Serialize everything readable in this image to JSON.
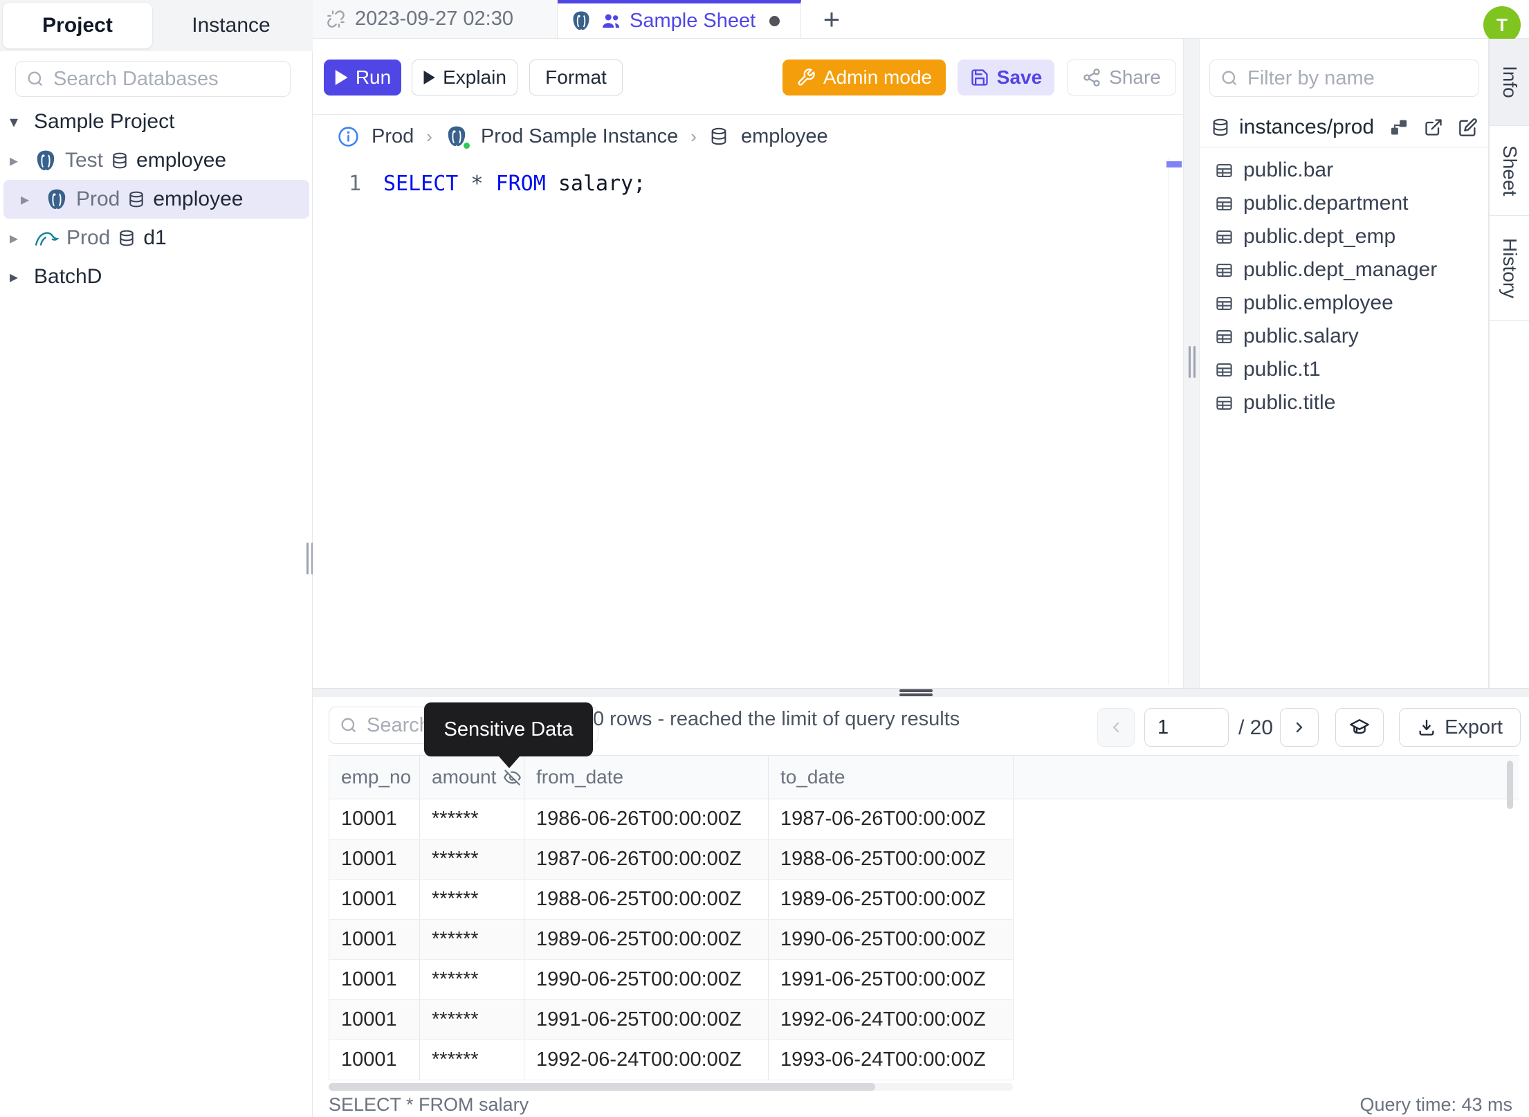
{
  "colors": {
    "accent_indigo": "#4f46e5",
    "admin_orange": "#f59e0b",
    "save_bg": "#e7e5fb",
    "avatar_green": "#7fc41f",
    "tooltip_bg": "#1d1d1f",
    "selected_row_bg": "#e9e8f9",
    "keyword_blue": "#0010f0",
    "status_dot_green": "#34c759"
  },
  "left_sidebar": {
    "tabs": [
      {
        "label": "Project",
        "active": true
      },
      {
        "label": "Instance",
        "active": false
      }
    ],
    "search_placeholder": "Search Databases",
    "tree": [
      {
        "kind": "project",
        "label": "Sample Project",
        "expanded": true,
        "selected": false
      },
      {
        "kind": "database",
        "env": "Test",
        "db": "employee",
        "engine": "postgres",
        "selected": false
      },
      {
        "kind": "database",
        "env": "Prod",
        "db": "employee",
        "engine": "postgres",
        "selected": true
      },
      {
        "kind": "database",
        "env": "Prod",
        "db": "d1",
        "engine": "mysql",
        "selected": false
      },
      {
        "kind": "project",
        "label": "BatchD",
        "expanded": false,
        "selected": false
      }
    ]
  },
  "tab_bar": {
    "tab1_label": "2023-09-27 02:30",
    "tab2_label": "Sample Sheet",
    "new_tab_label": "+",
    "avatar_initial": "T"
  },
  "toolbar": {
    "run_label": "Run",
    "explain_label": "Explain",
    "format_label": "Format",
    "admin_label": "Admin mode",
    "save_label": "Save",
    "share_label": "Share"
  },
  "breadcrumb": {
    "environment": "Prod",
    "instance": "Prod Sample Instance",
    "database": "employee",
    "separator": "›"
  },
  "editor": {
    "line_number": "1",
    "sql_tokens": [
      {
        "text": "SELECT",
        "type": "keyword"
      },
      {
        "text": " * ",
        "type": "operator"
      },
      {
        "text": "FROM",
        "type": "keyword"
      },
      {
        "text": " salary;",
        "type": "plain"
      }
    ]
  },
  "right_sidebar": {
    "filter_placeholder": "Filter by name",
    "connection": "instances/prod",
    "tables": [
      "public.bar",
      "public.department",
      "public.dept_emp",
      "public.dept_manager",
      "public.employee",
      "public.salary",
      "public.t1",
      "public.title"
    ],
    "side_tabs": [
      {
        "label": "Info",
        "active": true
      },
      {
        "label": "Sheet",
        "active": false
      },
      {
        "label": "History",
        "active": false
      }
    ]
  },
  "results": {
    "search_placeholder": "Search",
    "tooltip": "Sensitive Data",
    "summary": "0 rows  -  reached the limit of query results",
    "pagination": {
      "page": "1",
      "total": "/ 20"
    },
    "export_label": "Export",
    "columns": [
      {
        "name": "emp_no",
        "masked": false
      },
      {
        "name": "amount",
        "masked": true
      },
      {
        "name": "from_date",
        "masked": false
      },
      {
        "name": "to_date",
        "masked": false
      }
    ],
    "rows": [
      [
        "10001",
        "******",
        "1986-06-26T00:00:00Z",
        "1987-06-26T00:00:00Z"
      ],
      [
        "10001",
        "******",
        "1987-06-26T00:00:00Z",
        "1988-06-25T00:00:00Z"
      ],
      [
        "10001",
        "******",
        "1988-06-25T00:00:00Z",
        "1989-06-25T00:00:00Z"
      ],
      [
        "10001",
        "******",
        "1989-06-25T00:00:00Z",
        "1990-06-25T00:00:00Z"
      ],
      [
        "10001",
        "******",
        "1990-06-25T00:00:00Z",
        "1991-06-25T00:00:00Z"
      ],
      [
        "10001",
        "******",
        "1991-06-25T00:00:00Z",
        "1992-06-24T00:00:00Z"
      ],
      [
        "10001",
        "******",
        "1992-06-24T00:00:00Z",
        "1993-06-24T00:00:00Z"
      ]
    ],
    "status_query": "SELECT * FROM salary",
    "status_time": "Query time: 43 ms"
  }
}
